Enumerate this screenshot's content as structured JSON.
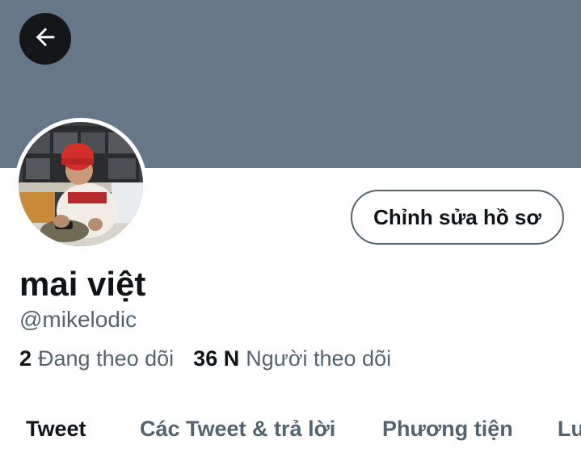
{
  "colors": {
    "banner": "#66778a",
    "back_button_bg": "#14171a",
    "primary_text": "#0f1419",
    "secondary_text": "#536471",
    "button_border": "#536471"
  },
  "header": {
    "back_icon": "arrow-left-icon"
  },
  "profile": {
    "edit_button_label": "Chỉnh sửa hồ sơ",
    "display_name": "mai việt",
    "handle": "@mikelodic",
    "following_count": "2",
    "following_label": "Đang theo dõi",
    "followers_count": "36 N",
    "followers_label": "Người theo dõi"
  },
  "tabs": [
    {
      "label": "Tweet",
      "active": true
    },
    {
      "label": "Các Tweet & trả lời",
      "active": false
    },
    {
      "label": "Phương tiện",
      "active": false
    },
    {
      "label": "Lu",
      "active": false
    }
  ]
}
